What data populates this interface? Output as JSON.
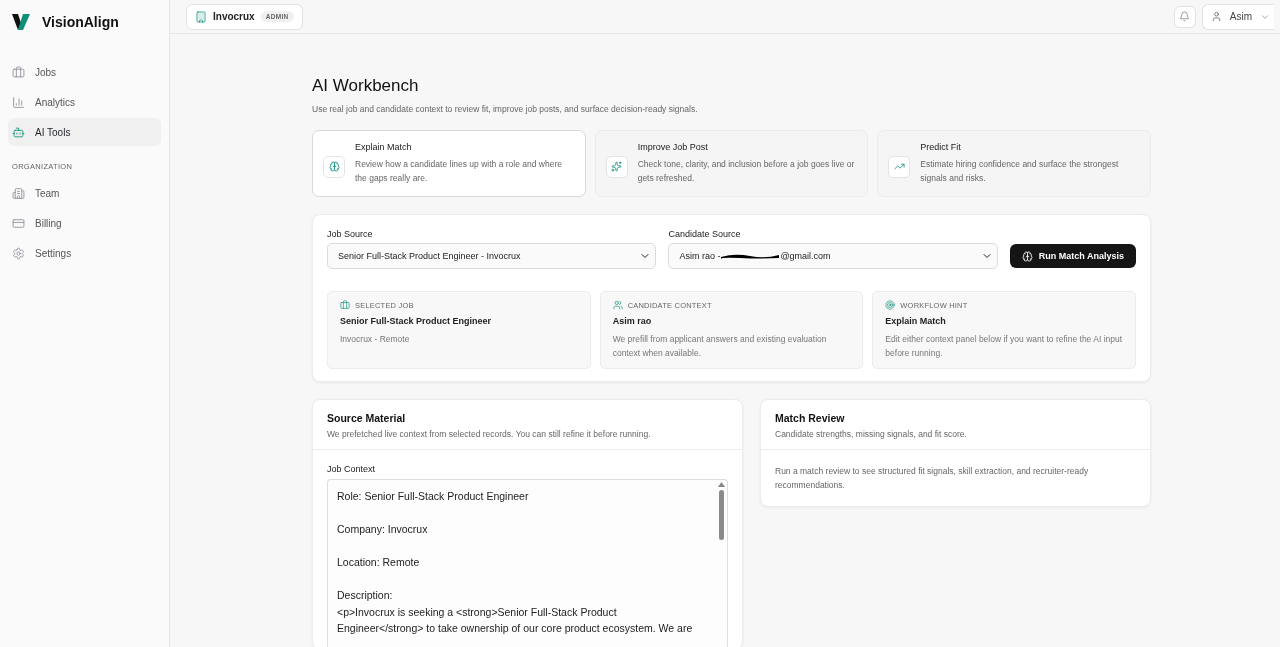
{
  "brand": "VisionAlign",
  "nav": [
    {
      "label": "Jobs",
      "selected": false
    },
    {
      "label": "Analytics",
      "selected": false
    },
    {
      "label": "AI Tools",
      "selected": true
    }
  ],
  "nav_section": "ORGANIZATION",
  "org_nav": [
    {
      "label": "Team",
      "selected": false
    },
    {
      "label": "Billing",
      "selected": false
    },
    {
      "label": "Settings",
      "selected": false
    }
  ],
  "workspace": {
    "name": "Invocrux",
    "role": "ADMIN"
  },
  "user": {
    "name": "Asim"
  },
  "title": "AI Workbench",
  "subtitle": "Use real job and candidate context to review fit, improve job posts, and surface decision-ready signals.",
  "modes": [
    {
      "title": "Explain Match",
      "description": "Review how a candidate lines up with a role and where the gaps really are.",
      "selected": true
    },
    {
      "title": "Improve Job Post",
      "description": "Check tone, clarity, and inclusion before a job goes live or gets refreshed.",
      "selected": false
    },
    {
      "title": "Predict Fit",
      "description": "Estimate hiring confidence and surface the strongest signals and risks.",
      "selected": false
    }
  ],
  "job_source": {
    "label": "Job Source",
    "value": "Senior Full-Stack Product Engineer - Invocrux"
  },
  "candidate_source": {
    "label": "Candidate Source",
    "value_start": "Asim rao - ",
    "value_end": "@gmail.com"
  },
  "run_button": "Run Match Analysis",
  "context_cards": [
    {
      "eyebrow": "SELECTED JOB",
      "title": "Senior Full-Stack Product Engineer",
      "text": "Invocrux - Remote"
    },
    {
      "eyebrow": "CANDIDATE CONTEXT",
      "title": "Asim rao",
      "text": "We prefill from applicant answers and existing evaluation context when available."
    },
    {
      "eyebrow": "WORKFLOW HINT",
      "title": "Explain Match",
      "text": "Edit either context panel below if you want to refine the AI input before running."
    }
  ],
  "source_material": {
    "title": "Source Material",
    "subtitle": "We prefetched live context from selected records. You can still refine it before running.",
    "field_label": "Job Context",
    "field_value": "Role: Senior Full-Stack Product Engineer\n\nCompany: Invocrux\n\nLocation: Remote\n\nDescription:\n<p>Invocrux is seeking a <strong>Senior Full-Stack Product Engineer</strong> to take ownership of our core product ecosystem. We are"
  },
  "match_review": {
    "title": "Match Review",
    "subtitle": "Candidate strengths, missing signals, and fit score.",
    "empty_text": "Run a match review to see structured fit signals, skill extraction, and recruiter-ready recommendations."
  }
}
